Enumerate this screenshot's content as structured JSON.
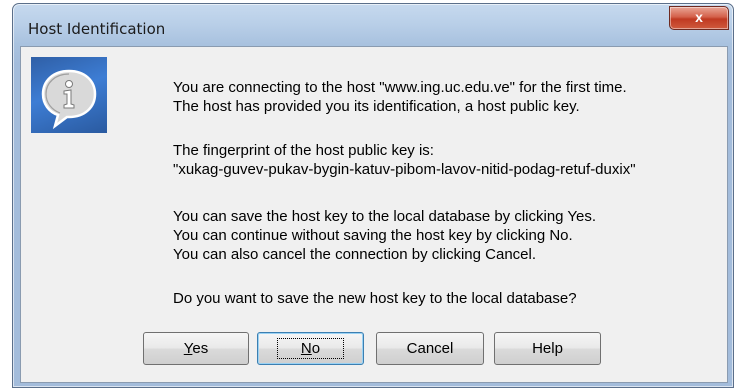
{
  "window": {
    "title": "Host Identification",
    "close_label": "x"
  },
  "message": {
    "line1": "You are connecting to the host \"www.ing.uc.edu.ve\" for the first time.",
    "line2": "The host has provided you its identification, a host public key.",
    "line3": "The fingerprint of the host public key is:",
    "line4": "\"xukag-guvev-pukav-bygin-katuv-pibom-lavov-nitid-podag-retuf-duxix\"",
    "line5": "You can save the host key to the local database by clicking Yes.",
    "line6": "You can continue without saving the host key by clicking No.",
    "line7": "You can also cancel the connection by clicking Cancel.",
    "line8": "Do you want to save the new host key to the local database?"
  },
  "buttons": {
    "yes_accel": "Y",
    "yes_rest": "es",
    "no_accel": "N",
    "no_rest": "o",
    "cancel": "Cancel",
    "help": "Help"
  },
  "icons": {
    "dialog_icon": "info-speech-bubble-icon",
    "close_icon": "close-icon"
  },
  "colors": {
    "title_bar": "#b9cfe8",
    "close_button": "#c03a22",
    "icon_background": "#3d7dd4",
    "dialog_background": "#f0f0f0"
  }
}
